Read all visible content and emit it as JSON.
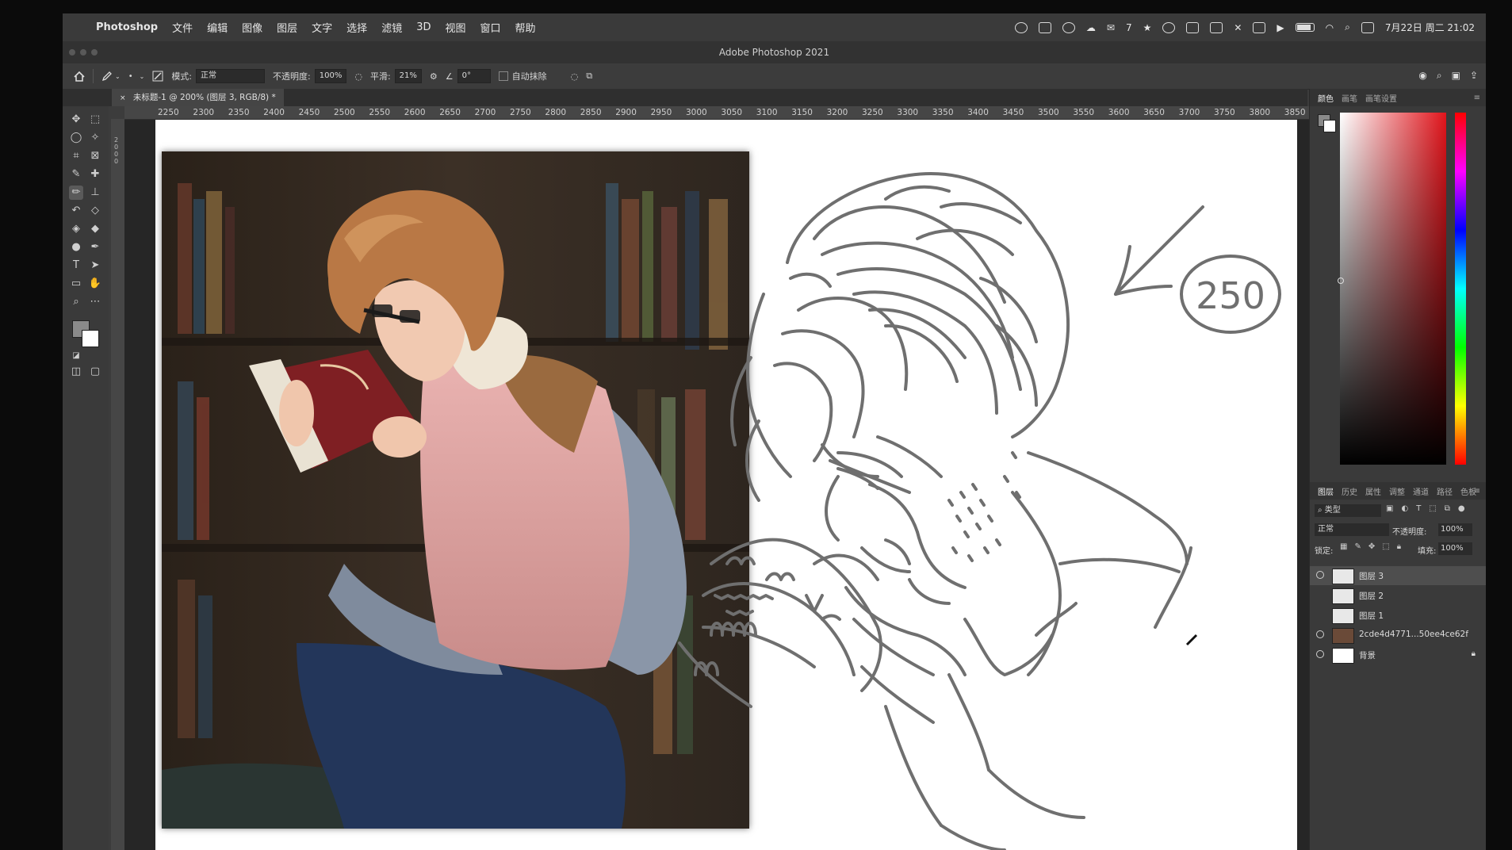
{
  "menubar": {
    "app_name": "Photoshop",
    "items": [
      "文件",
      "编辑",
      "图像",
      "图层",
      "文字",
      "选择",
      "滤镜",
      "3D",
      "视图",
      "窗口",
      "帮助"
    ],
    "status_wechat_count": "7",
    "clock": "7月22日 周二 21:02"
  },
  "titlebar": {
    "title": "Adobe Photoshop 2021"
  },
  "options": {
    "mode_label": "模式:",
    "mode_value": "正常",
    "opacity_label": "不透明度:",
    "opacity_value": "100%",
    "smooth_label": "平滑:",
    "smooth_value": "21%",
    "angle_value": "0°",
    "auto_erase_label": "自动抹除"
  },
  "document": {
    "tab_label": "未标题-1 @ 200% (图层 3, RGB/8) *"
  },
  "ruler": {
    "ticks": [
      "2250",
      "2300",
      "2350",
      "2400",
      "2450",
      "2500",
      "2550",
      "2600",
      "2650",
      "2700",
      "2750",
      "2800",
      "2850",
      "2900",
      "2950",
      "3000",
      "3050",
      "3100",
      "3150",
      "3200",
      "3250",
      "3300",
      "3350",
      "3400",
      "3450",
      "3500",
      "3550",
      "3600",
      "3650",
      "3700",
      "3750",
      "3800",
      "3850"
    ],
    "vertical_ticks": [
      "2",
      "0",
      "0",
      "0"
    ]
  },
  "sketch": {
    "annotation": "250"
  },
  "color_panel": {
    "tabs": [
      "颜色",
      "画笔",
      "画笔设置"
    ]
  },
  "layers_panel": {
    "tabs": [
      "图层",
      "历史",
      "属性",
      "调整",
      "通道",
      "路径",
      "色板"
    ],
    "filter_label": "类型",
    "blend_mode": "正常",
    "opacity_label": "不透明度:",
    "opacity_value": "100%",
    "lock_label": "锁定:",
    "fill_label": "填充:",
    "fill_value": "100%",
    "layers": [
      {
        "name": "图层 3",
        "visible": true,
        "selected": true
      },
      {
        "name": "图层 2",
        "visible": false,
        "selected": false
      },
      {
        "name": "图层 1",
        "visible": false,
        "selected": false
      },
      {
        "name": "2cde4d4771...50ee4ce62f",
        "visible": true,
        "selected": false
      },
      {
        "name": "背景",
        "visible": true,
        "selected": false
      }
    ]
  },
  "colors": {
    "foreground": "#8a8a8a",
    "background": "#ffffff",
    "picker_hue": "#e0141b",
    "sketch_stroke": "#6f6f6f"
  }
}
